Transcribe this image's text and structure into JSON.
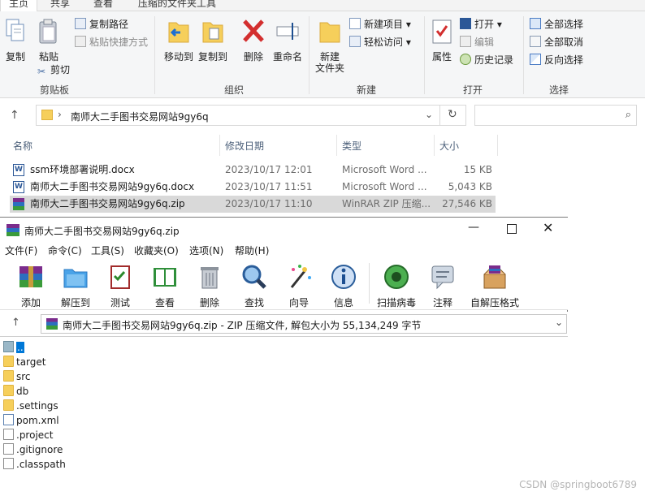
{
  "ribbon": {
    "tabs": [
      "主页",
      "共享",
      "查看",
      "压缩的文件夹工具"
    ],
    "clipboard": {
      "copy": "复制",
      "paste": "粘贴",
      "copy_path": "复制路径",
      "paste_shortcut": "粘贴快捷方式",
      "cut": "剪切",
      "group": "剪贴板"
    },
    "organize": {
      "move_to": "移动到",
      "copy_to": "复制到",
      "delete": "删除",
      "rename": "重命名",
      "group": "组织"
    },
    "new": {
      "new_item": "新建项目",
      "easy_access": "轻松访问",
      "new_folder": "新建\n文件夹",
      "group": "新建"
    },
    "open": {
      "properties": "属性",
      "open": "打开",
      "edit": "编辑",
      "history": "历史记录",
      "group": "打开"
    },
    "select": {
      "select_all": "全部选择",
      "select_none": "全部取消",
      "invert": "反向选择",
      "group": "选择"
    }
  },
  "address": {
    "path": "南师大二手图书交易网站9gy6q"
  },
  "columns": {
    "name": "名称",
    "date": "修改日期",
    "type": "类型",
    "size": "大小"
  },
  "files": [
    {
      "name": "ssm环境部署说明.docx",
      "date": "2023/10/17 12:01",
      "type": "Microsoft Word ...",
      "size": "15 KB",
      "icon": "word-icon"
    },
    {
      "name": "南师大二手图书交易网站9gy6q.docx",
      "date": "2023/10/17 11:51",
      "type": "Microsoft Word ...",
      "size": "5,043 KB",
      "icon": "word-icon"
    },
    {
      "name": "南师大二手图书交易网站9gy6q.zip",
      "date": "2023/10/17 11:10",
      "type": "WinRAR ZIP 压缩...",
      "size": "27,546 KB",
      "icon": "winrar-icon"
    }
  ],
  "rar": {
    "title": "南师大二手图书交易网站9gy6q.zip",
    "menu": [
      "文件(F)",
      "命令(C)",
      "工具(S)",
      "收藏夹(O)",
      "选项(N)",
      "帮助(H)"
    ],
    "tools": [
      "添加",
      "解压到",
      "测试",
      "查看",
      "删除",
      "查找",
      "向导",
      "信息",
      "扫描病毒",
      "注释",
      "自解压格式"
    ],
    "path": "南师大二手图书交易网站9gy6q.zip - ZIP 压缩文件, 解包大小为 55,134,249 字节",
    "items": [
      {
        "name": "..",
        "kind": "up"
      },
      {
        "name": "target",
        "kind": "folder"
      },
      {
        "name": "src",
        "kind": "folder"
      },
      {
        "name": "db",
        "kind": "folder"
      },
      {
        "name": ".settings",
        "kind": "folder"
      },
      {
        "name": "pom.xml",
        "kind": "xml"
      },
      {
        "name": ".project",
        "kind": "file"
      },
      {
        "name": ".gitignore",
        "kind": "file"
      },
      {
        "name": ".classpath",
        "kind": "file"
      }
    ]
  },
  "watermark": "CSDN @springboot6789",
  "colors": {
    "accent": "#0078d7",
    "folder": "#f6cf5b",
    "selection": "#d9d9d9"
  }
}
